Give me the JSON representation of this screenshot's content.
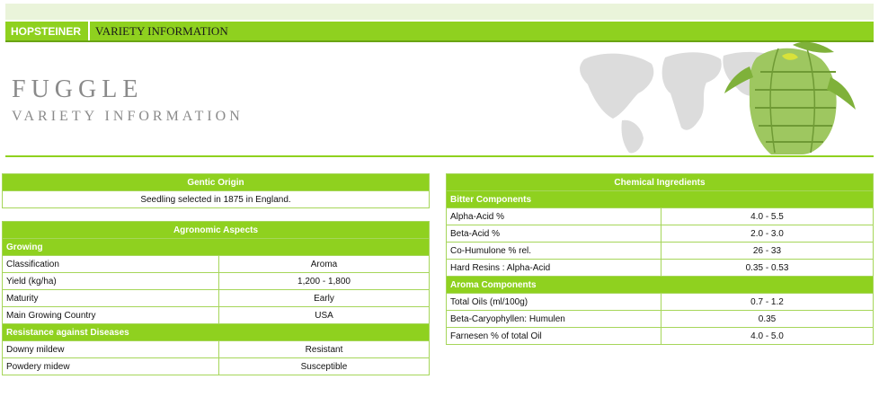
{
  "header": {
    "brand": "HOPSTEINER",
    "section": "VARIETY INFORMATION"
  },
  "hero": {
    "title": "FUGGLE",
    "subtitle": "VARIETY INFORMATION"
  },
  "genetic_origin": {
    "title": "Gentic Origin",
    "text": "Seedling selected in 1875 in England."
  },
  "agronomic": {
    "title": "Agronomic Aspects",
    "growing": {
      "label": "Growing",
      "rows": [
        {
          "label": "Classification",
          "value": "Aroma"
        },
        {
          "label": "Yield (kg/ha)",
          "value": "1,200 - 1,800"
        },
        {
          "label": "Maturity",
          "value": "Early"
        },
        {
          "label": "Main Growing Country",
          "value": "USA"
        }
      ]
    },
    "resistance": {
      "label": "Resistance against Diseases",
      "rows": [
        {
          "label": "Downy mildew",
          "value": "Resistant"
        },
        {
          "label": "Powdery midew",
          "value": "Susceptible"
        }
      ]
    }
  },
  "chemical": {
    "title": "Chemical Ingredients",
    "bitter": {
      "label": "Bitter Components",
      "rows": [
        {
          "label": "Alpha-Acid %",
          "value": "4.0 - 5.5"
        },
        {
          "label": "Beta-Acid %",
          "value": "2.0 - 3.0"
        },
        {
          "label": "Co-Humulone % rel.",
          "value": "26 - 33"
        },
        {
          "label": "Hard Resins : Alpha-Acid",
          "value": "0.35 - 0.53"
        }
      ]
    },
    "aroma": {
      "label": "Aroma Components",
      "rows": [
        {
          "label": "Total Oils (ml/100g)",
          "value": "0.7 - 1.2"
        },
        {
          "label": "Beta-Caryophyllen: Humulen",
          "value": "0.35"
        },
        {
          "label": "Farnesen % of total Oil",
          "value": "4.0 - 5.0"
        }
      ]
    }
  },
  "colors": {
    "accent": "#8fd11f",
    "accent_light": "#eaf4da",
    "border": "#a6d65a",
    "title_gray": "#8a8a8a"
  },
  "icons": {
    "hero_art": "world-map-hop-cone-illustration"
  }
}
